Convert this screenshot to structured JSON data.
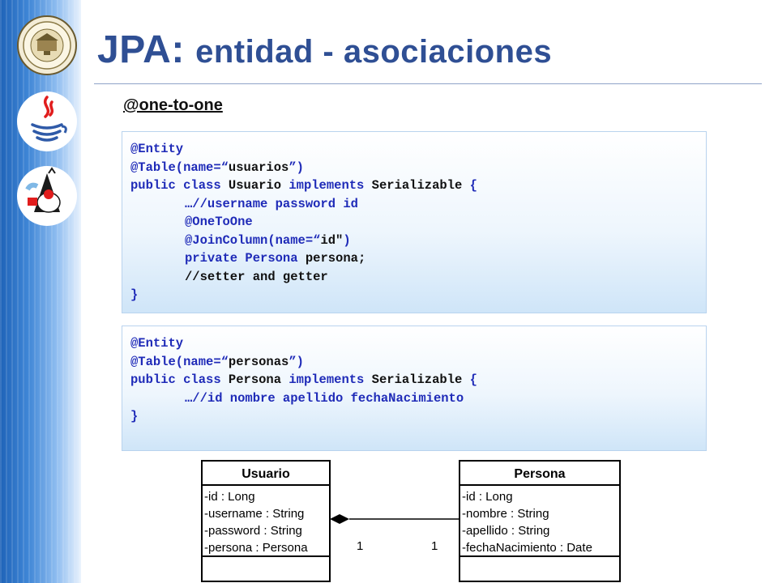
{
  "title": {
    "main": "JPA:",
    "sub": "entidad - asociaciones"
  },
  "subtitle": "@one-to-one",
  "code_block_1": [
    {
      "indent": false,
      "parts": [
        {
          "t": "@Entity",
          "c": "kw"
        }
      ]
    },
    {
      "indent": false,
      "parts": [
        {
          "t": "@Table(name=“",
          "c": "kw"
        },
        {
          "t": "usuarios",
          "c": "id"
        },
        {
          "t": "”)",
          "c": "kw"
        }
      ]
    },
    {
      "indent": false,
      "parts": [
        {
          "t": "public class ",
          "c": "kw"
        },
        {
          "t": "Usuario ",
          "c": "id"
        },
        {
          "t": "implements ",
          "c": "kw"
        },
        {
          "t": "Serializable ",
          "c": "id"
        },
        {
          "t": "{",
          "c": "kw"
        }
      ]
    },
    {
      "indent": true,
      "parts": [
        {
          "t": "…//username password id",
          "c": "kw"
        }
      ]
    },
    {
      "indent": true,
      "parts": [
        {
          "t": "@OneToOne",
          "c": "kw"
        }
      ]
    },
    {
      "indent": true,
      "parts": [
        {
          "t": "@JoinColumn(name=“",
          "c": "kw"
        },
        {
          "t": "id\"",
          "c": "id"
        },
        {
          "t": ")",
          "c": "kw"
        }
      ]
    },
    {
      "indent": true,
      "parts": [
        {
          "t": "private ",
          "c": "kw"
        },
        {
          "t": "Persona ",
          "c": "kw"
        },
        {
          "t": "persona;",
          "c": "id"
        }
      ]
    },
    {
      "indent": true,
      "parts": [
        {
          "t": "//setter and getter",
          "c": "id"
        }
      ]
    },
    {
      "indent": false,
      "parts": [
        {
          "t": "}",
          "c": "kw"
        }
      ]
    }
  ],
  "code_block_2": [
    {
      "indent": false,
      "parts": [
        {
          "t": "@Entity",
          "c": "kw"
        }
      ]
    },
    {
      "indent": false,
      "parts": [
        {
          "t": "@Table(name=“",
          "c": "kw"
        },
        {
          "t": "personas",
          "c": "id"
        },
        {
          "t": "”)",
          "c": "kw"
        }
      ]
    },
    {
      "indent": false,
      "parts": [
        {
          "t": "public class ",
          "c": "kw"
        },
        {
          "t": "Persona ",
          "c": "id"
        },
        {
          "t": "implements ",
          "c": "kw"
        },
        {
          "t": "Serializable ",
          "c": "id"
        },
        {
          "t": "{",
          "c": "kw"
        }
      ]
    },
    {
      "indent": true,
      "parts": [
        {
          "t": "…//id nombre apellido fechaNacimiento",
          "c": "kw"
        }
      ]
    },
    {
      "indent": false,
      "parts": [
        {
          "t": "}",
          "c": "kw"
        }
      ]
    }
  ],
  "uml": {
    "class_left": {
      "name": "Usuario",
      "attributes": [
        "-id : Long",
        "-username : String",
        "-password : String",
        "-persona : Persona"
      ]
    },
    "class_right": {
      "name": "Persona",
      "attributes": [
        "-id : Long",
        "-nombre : String",
        "-apellido : String",
        "-fechaNacimiento : Date"
      ]
    },
    "multiplicity_left": "1",
    "multiplicity_right": "1"
  },
  "icons": [
    "university-seal-icon",
    "java-logo-icon",
    "duke-mascot-icon"
  ],
  "colors": {
    "title": "#2f4f94",
    "keyword": "#1f2bb8",
    "text": "#111111",
    "band": "#3f86d6"
  }
}
